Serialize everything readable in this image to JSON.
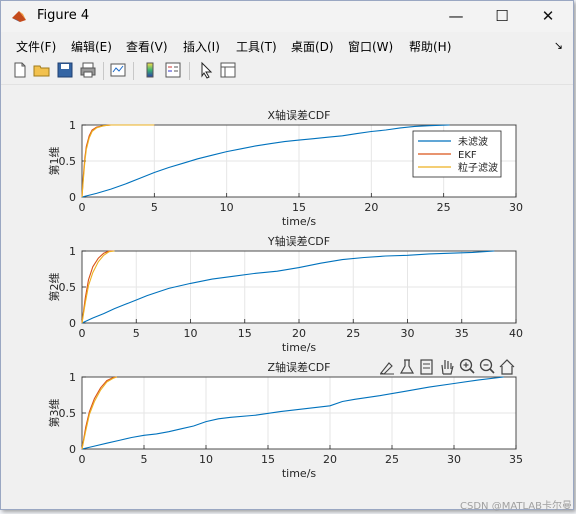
{
  "window": {
    "title": "Figure 4"
  },
  "menu": [
    {
      "label": "文件(F)"
    },
    {
      "label": "编辑(E)"
    },
    {
      "label": "查看(V)"
    },
    {
      "label": "插入(I)"
    },
    {
      "label": "工具(T)"
    },
    {
      "label": "桌面(D)"
    },
    {
      "label": "窗口(W)"
    },
    {
      "label": "帮助(H)"
    }
  ],
  "toolbar_icons": [
    "new-figure-icon",
    "open-file-icon",
    "save-icon",
    "print-icon",
    "link-plot-icon",
    "insert-colorbar-icon",
    "insert-legend-icon",
    "edit-plot-arrow-icon",
    "property-inspector-icon"
  ],
  "axes_toolbar_icons": [
    "brush-icon",
    "data-tips-icon",
    "restore-view-icon",
    "pan-hand-icon",
    "zoom-in-icon",
    "zoom-out-icon",
    "home-icon"
  ],
  "colors": {
    "series1": "#0072BD",
    "series2": "#D95319",
    "series3": "#EDB120"
  },
  "chart_data": [
    {
      "type": "line",
      "title": "X轴误差CDF",
      "xlabel": "time/s",
      "ylabel": "第1维",
      "xlim": [
        0,
        30
      ],
      "ylim": [
        0,
        1
      ],
      "xticks": [
        0,
        5,
        10,
        15,
        20,
        25,
        30
      ],
      "yticks": [
        0,
        0.5,
        1
      ],
      "grid": true,
      "legend": {
        "placement": "top-right",
        "entries": [
          "未滤波",
          "EKF",
          "粒子滤波"
        ]
      },
      "series": [
        {
          "name": "未滤波",
          "color": "#0072BD",
          "x": [
            0,
            1,
            2,
            3,
            4,
            5,
            6,
            7,
            8,
            9,
            10,
            11,
            12,
            13,
            14,
            15,
            16,
            17,
            18,
            19,
            20,
            21,
            22,
            23,
            24,
            25.4
          ],
          "y": [
            0,
            0.05,
            0.11,
            0.18,
            0.26,
            0.34,
            0.41,
            0.47,
            0.53,
            0.58,
            0.63,
            0.67,
            0.71,
            0.74,
            0.77,
            0.79,
            0.81,
            0.83,
            0.85,
            0.88,
            0.91,
            0.93,
            0.96,
            0.98,
            0.99,
            1.0
          ]
        },
        {
          "name": "EKF",
          "color": "#D95319",
          "x": [
            0,
            0.1,
            0.2,
            0.3,
            0.5,
            0.7,
            1.0,
            1.5,
            2.0,
            3.0,
            5.0
          ],
          "y": [
            0,
            0.3,
            0.55,
            0.7,
            0.85,
            0.93,
            0.97,
            0.99,
            1.0,
            1.0,
            1.0
          ]
        },
        {
          "name": "粒子滤波",
          "color": "#EDB120",
          "x": [
            0,
            0.1,
            0.2,
            0.3,
            0.5,
            0.7,
            1.0,
            1.5,
            2.0,
            3.0,
            5.0
          ],
          "y": [
            0,
            0.25,
            0.5,
            0.66,
            0.82,
            0.91,
            0.96,
            0.99,
            1.0,
            1.0,
            1.0
          ]
        }
      ]
    },
    {
      "type": "line",
      "title": "Y轴误差CDF",
      "xlabel": "time/s",
      "ylabel": "第2维",
      "xlim": [
        0,
        40
      ],
      "ylim": [
        0,
        1
      ],
      "xticks": [
        0,
        5,
        10,
        15,
        20,
        25,
        30,
        35,
        40
      ],
      "yticks": [
        0,
        0.5,
        1
      ],
      "grid": true,
      "series": [
        {
          "name": "未滤波",
          "color": "#0072BD",
          "x": [
            0,
            1,
            2,
            3,
            4,
            5,
            6,
            7,
            8,
            10,
            12,
            14,
            16,
            18,
            20,
            22,
            24,
            26,
            28,
            30,
            32,
            34,
            36,
            38
          ],
          "y": [
            0,
            0.07,
            0.13,
            0.2,
            0.26,
            0.32,
            0.38,
            0.43,
            0.48,
            0.55,
            0.61,
            0.65,
            0.69,
            0.72,
            0.77,
            0.83,
            0.88,
            0.91,
            0.93,
            0.94,
            0.96,
            0.97,
            0.98,
            1.0
          ]
        },
        {
          "name": "EKF",
          "color": "#D95319",
          "x": [
            0,
            0.3,
            0.6,
            1.0,
            1.5,
            2.0,
            2.5,
            3.0
          ],
          "y": [
            0,
            0.35,
            0.6,
            0.78,
            0.9,
            0.97,
            1.0,
            1.0
          ]
        },
        {
          "name": "粒子滤波",
          "color": "#EDB120",
          "x": [
            0,
            0.3,
            0.6,
            1.0,
            1.5,
            2.0,
            2.5,
            3.0
          ],
          "y": [
            0,
            0.28,
            0.52,
            0.7,
            0.85,
            0.94,
            0.99,
            1.0
          ]
        }
      ]
    },
    {
      "type": "line",
      "title": "Z轴误差CDF",
      "xlabel": "time/s",
      "ylabel": "第3维",
      "xlim": [
        0,
        35
      ],
      "ylim": [
        0,
        1
      ],
      "xticks": [
        0,
        5,
        10,
        15,
        20,
        25,
        30,
        35
      ],
      "yticks": [
        0,
        0.5,
        1
      ],
      "grid": true,
      "series": [
        {
          "name": "未滤波",
          "color": "#0072BD",
          "x": [
            0,
            1,
            2,
            3,
            4,
            5,
            6,
            7,
            8,
            9,
            10,
            11,
            12,
            14,
            16,
            18,
            20,
            21,
            22,
            24,
            26,
            28,
            30,
            32,
            34
          ],
          "y": [
            0,
            0.04,
            0.08,
            0.12,
            0.16,
            0.19,
            0.21,
            0.24,
            0.28,
            0.32,
            0.38,
            0.42,
            0.44,
            0.47,
            0.52,
            0.56,
            0.6,
            0.66,
            0.69,
            0.74,
            0.8,
            0.86,
            0.91,
            0.96,
            1.0
          ]
        },
        {
          "name": "EKF",
          "color": "#D95319",
          "x": [
            0,
            0.3,
            0.6,
            1.0,
            1.5,
            2.0,
            2.5,
            2.8
          ],
          "y": [
            0,
            0.3,
            0.52,
            0.7,
            0.85,
            0.95,
            0.99,
            1.0
          ]
        },
        {
          "name": "粒子滤波",
          "color": "#EDB120",
          "x": [
            0,
            0.3,
            0.6,
            1.0,
            1.5,
            2.0,
            2.5,
            2.8
          ],
          "y": [
            0,
            0.25,
            0.48,
            0.66,
            0.82,
            0.93,
            0.98,
            1.0
          ]
        }
      ]
    }
  ],
  "watermark": "CSDN @MATLAB卡尔曼"
}
